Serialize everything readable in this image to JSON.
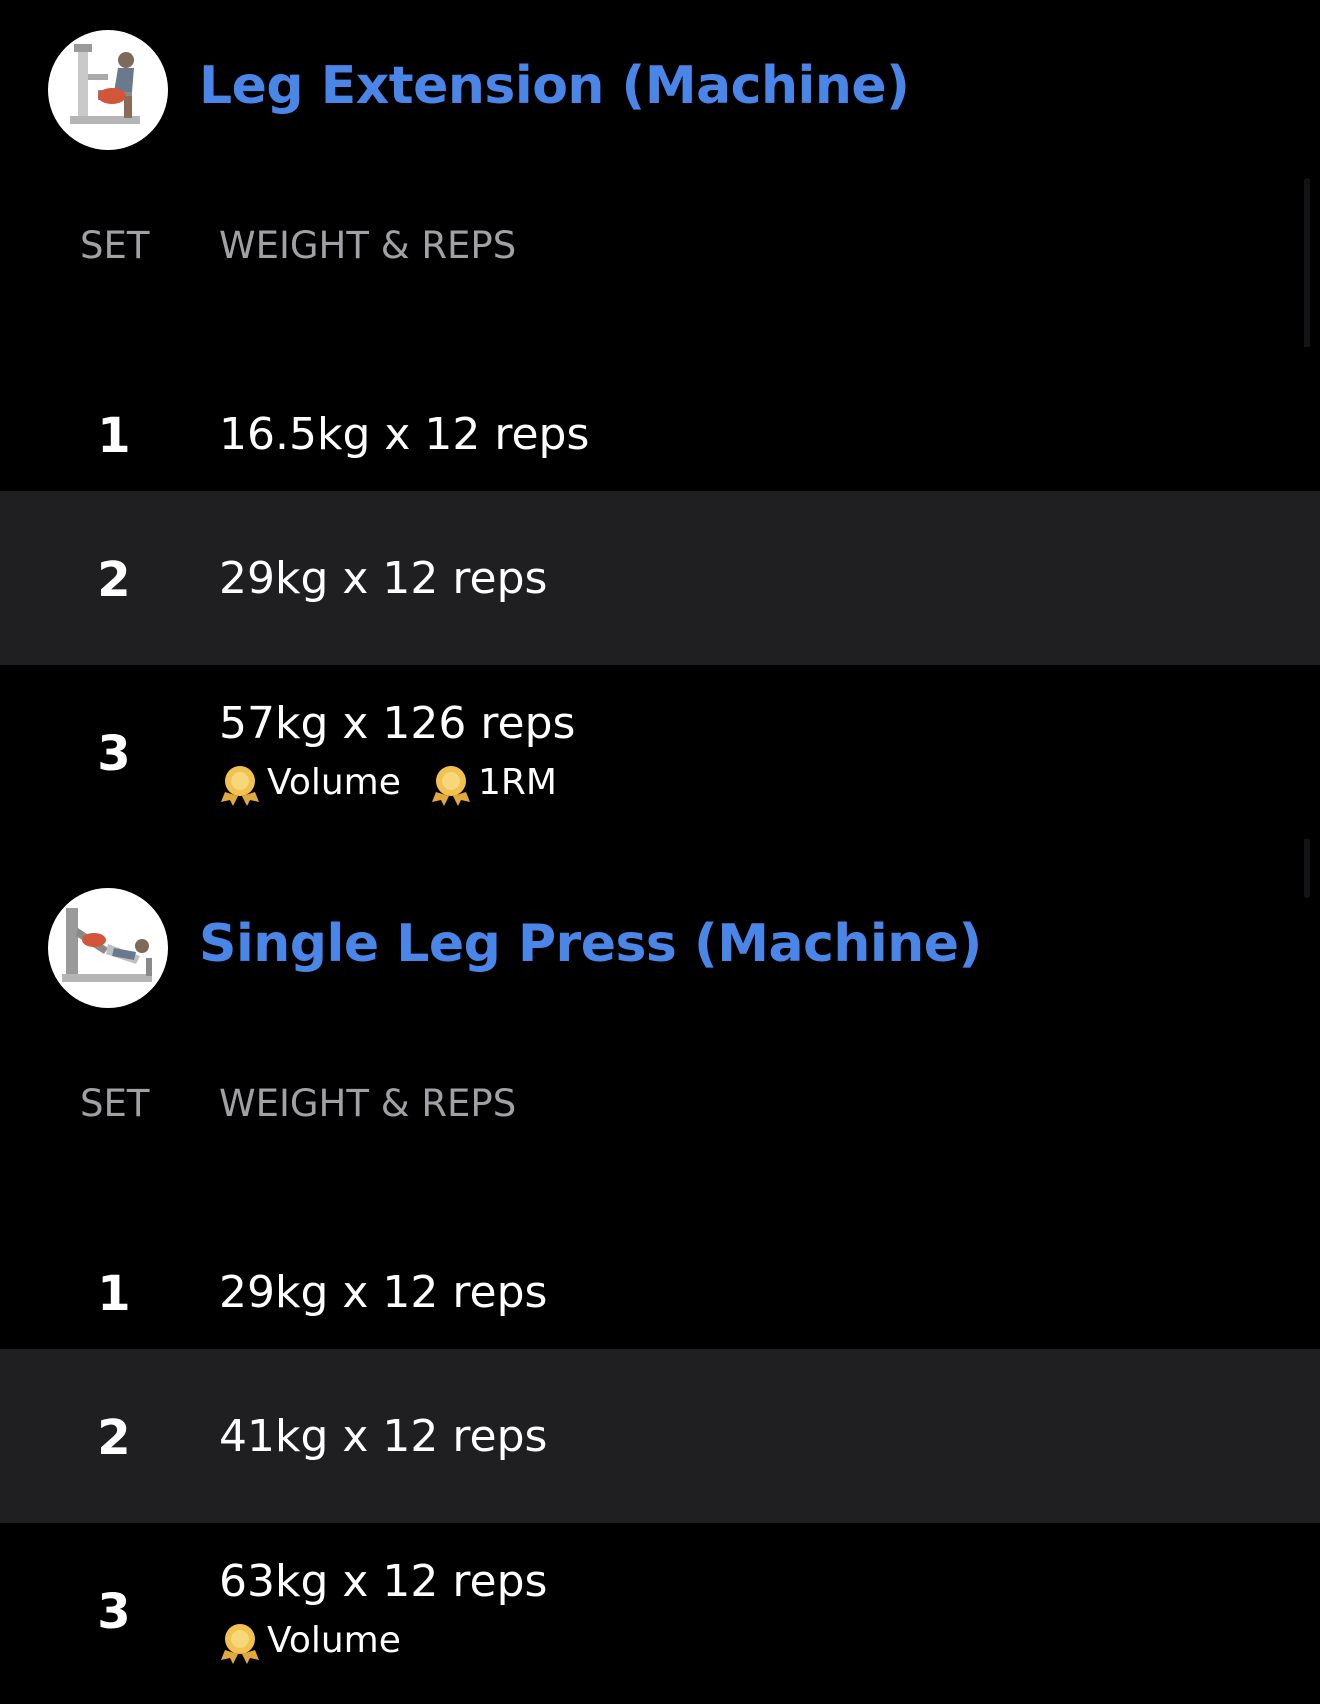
{
  "columns": {
    "set": "SET",
    "weight_reps": "WEIGHT & REPS"
  },
  "exercises": [
    {
      "title": "Leg Extension (Machine)",
      "thumbnail_icon": "leg-extension-machine-illustration",
      "sets": [
        {
          "number": "1",
          "value": "16.5kg x 12 reps",
          "badges": []
        },
        {
          "number": "2",
          "value": "29kg x 12 reps",
          "badges": []
        },
        {
          "number": "3",
          "value": "57kg x 126 reps",
          "badges": [
            {
              "icon": "medal-icon",
              "label": "Volume"
            },
            {
              "icon": "medal-icon",
              "label": "1RM"
            }
          ]
        }
      ]
    },
    {
      "title": "Single Leg Press (Machine)",
      "thumbnail_icon": "leg-press-machine-illustration",
      "sets": [
        {
          "number": "1",
          "value": "29kg x 12 reps",
          "badges": []
        },
        {
          "number": "2",
          "value": "41kg x 12 reps",
          "badges": []
        },
        {
          "number": "3",
          "value": "63kg x 12 reps",
          "badges": [
            {
              "icon": "medal-icon",
              "label": "Volume"
            }
          ]
        }
      ]
    }
  ],
  "colors": {
    "title_accent": "#4a86e8",
    "header_text": "#a0a0a5",
    "row_alt_background": "#1f1f21",
    "medal": "#f2c14e"
  }
}
